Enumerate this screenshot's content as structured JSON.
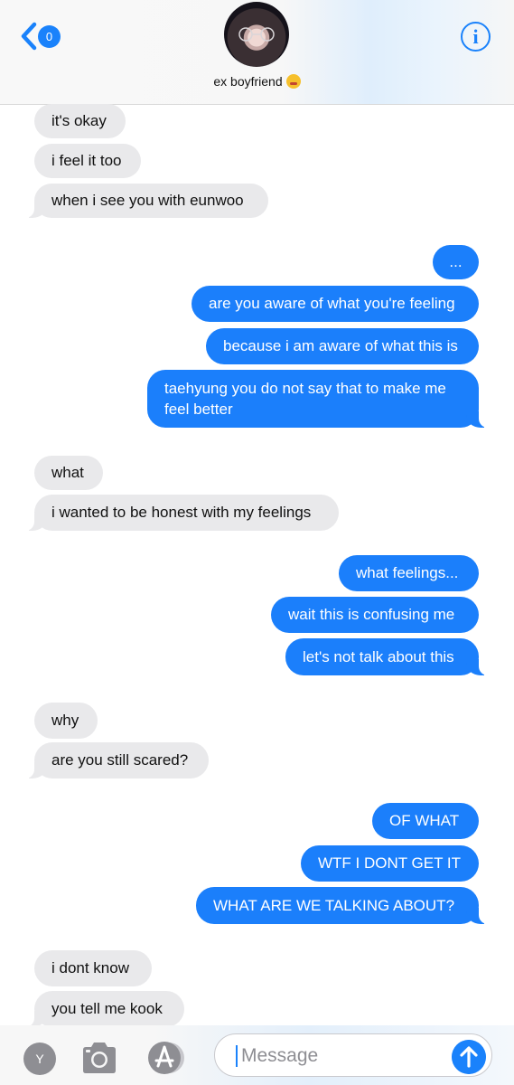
{
  "header": {
    "back_badge": "0",
    "contact_name": "ex boyfriend",
    "contact_emoji": "zany-face-emoji",
    "info_icon": "i"
  },
  "messages": [
    {
      "dir": "in",
      "text": "it's okay"
    },
    {
      "dir": "in",
      "text": "i feel it too"
    },
    {
      "dir": "in",
      "text": "when i see you with eunwoo"
    },
    {
      "dir": "out",
      "text": "..."
    },
    {
      "dir": "out",
      "text": "are you aware of what you're feeling"
    },
    {
      "dir": "out",
      "text": "because i am aware of what this is"
    },
    {
      "dir": "out",
      "text": "taehyung you do not say that to make me feel better"
    },
    {
      "dir": "in",
      "text": "what"
    },
    {
      "dir": "in",
      "text": "i wanted to be honest with my feelings"
    },
    {
      "dir": "out",
      "text": "what feelings..."
    },
    {
      "dir": "out",
      "text": "wait this is confusing me"
    },
    {
      "dir": "out",
      "text": "let's not talk about this"
    },
    {
      "dir": "in",
      "text": "why"
    },
    {
      "dir": "in",
      "text": "are you still scared?"
    },
    {
      "dir": "out",
      "text": "OF WHAT"
    },
    {
      "dir": "out",
      "text": "WTF I DONT GET IT"
    },
    {
      "dir": "out",
      "text": "WHAT ARE WE TALKING ABOUT?"
    },
    {
      "dir": "in",
      "text": "i dont know"
    },
    {
      "dir": "in",
      "text": "you tell me kook"
    }
  ],
  "input_bar": {
    "app_label": "Y",
    "placeholder": "Message"
  },
  "colors": {
    "accent": "#1a82fb",
    "incoming_bubble": "#e9e9eb",
    "outgoing_bubble": "#1b7ffb"
  }
}
